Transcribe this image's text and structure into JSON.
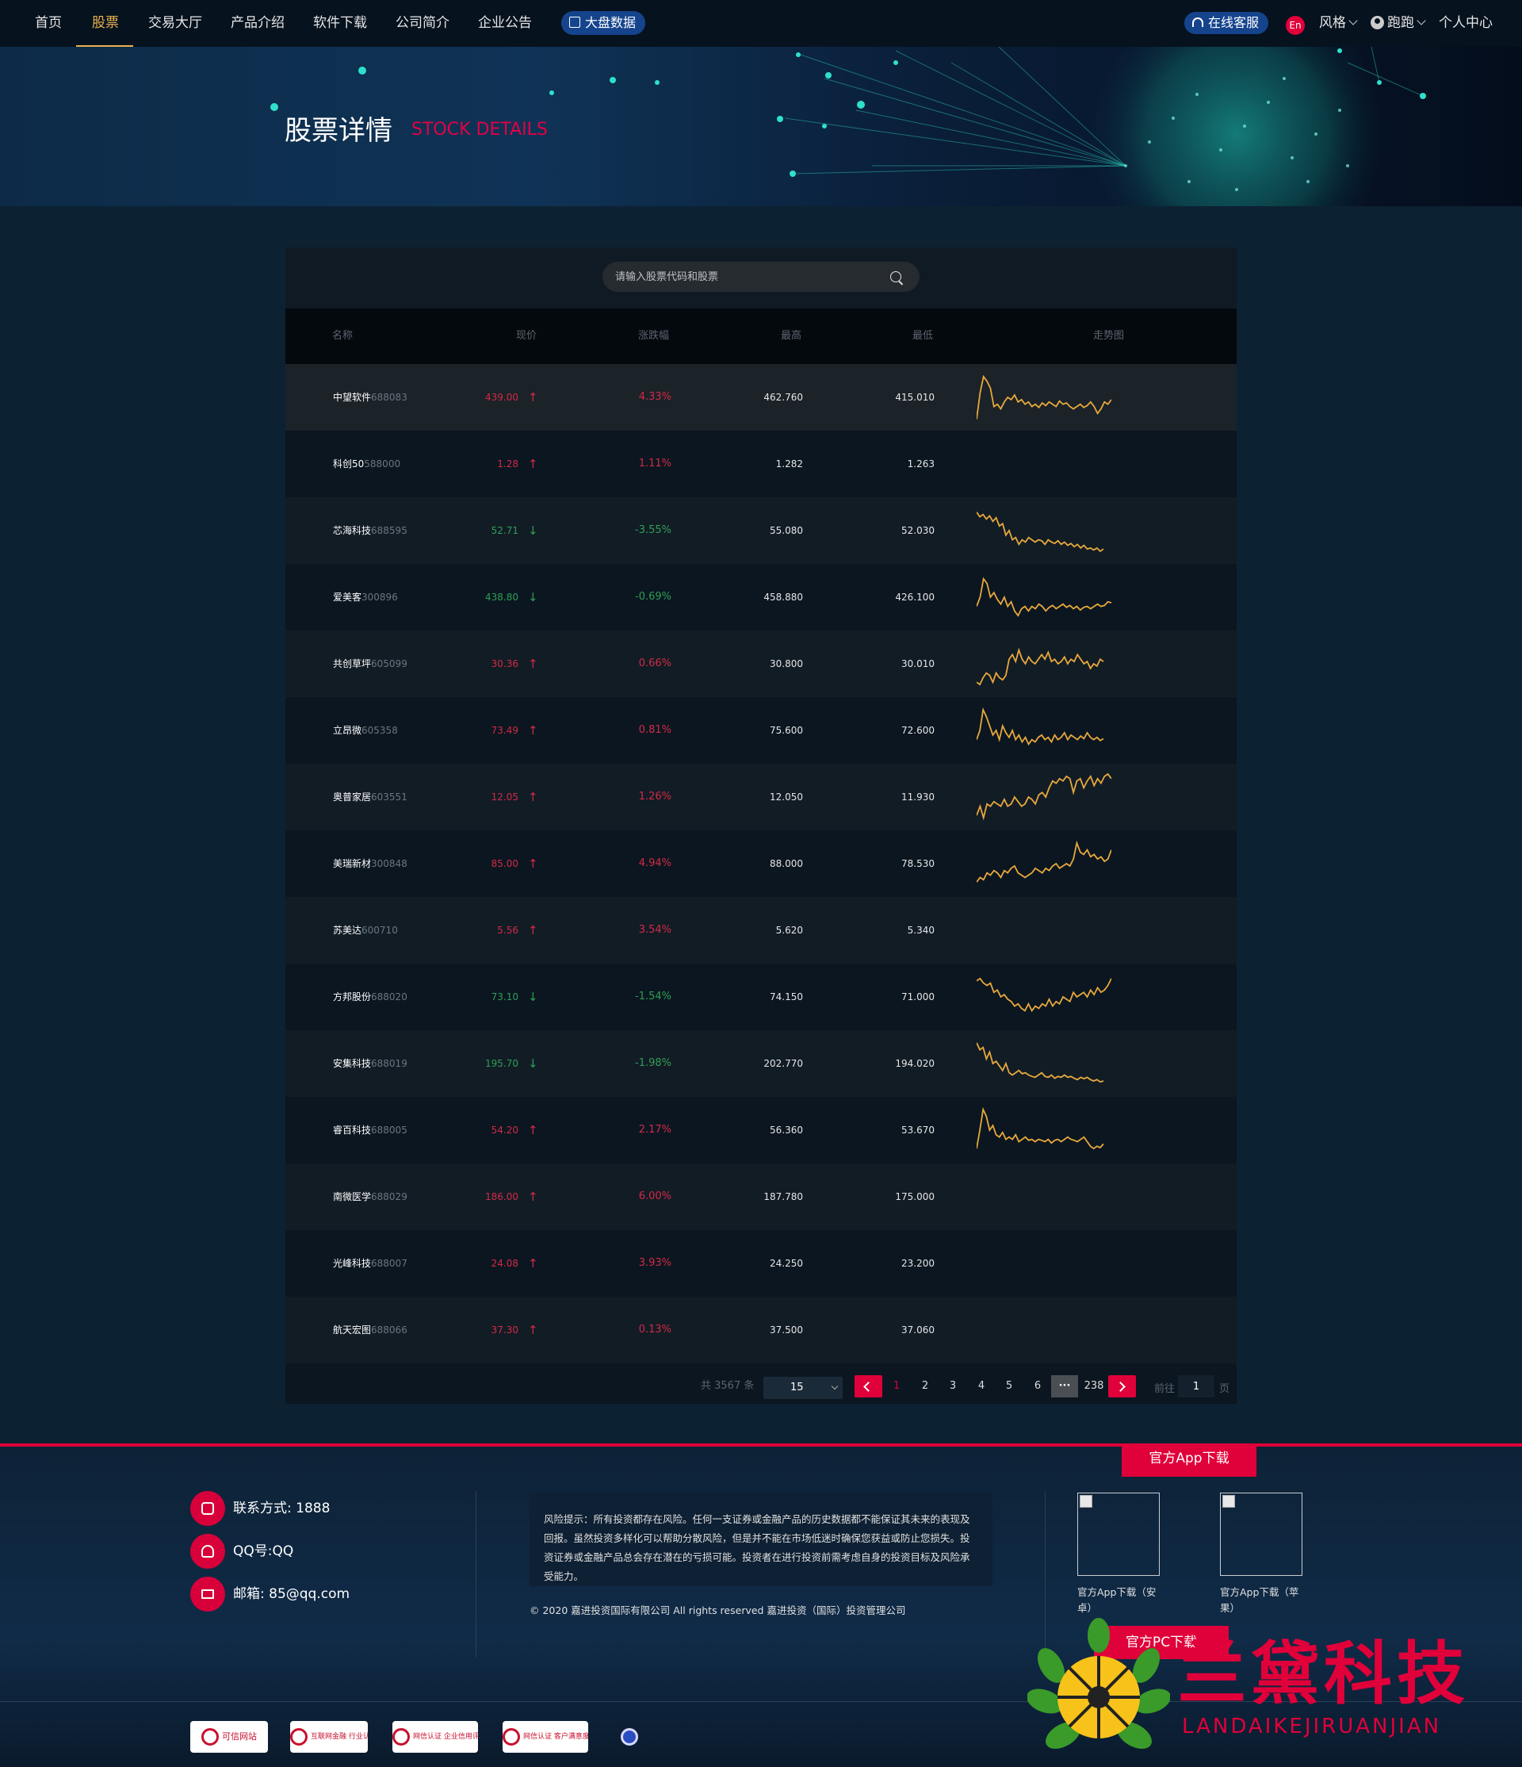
{
  "nav": {
    "items": [
      {
        "label": "首页"
      },
      {
        "label": "股票"
      },
      {
        "label": "交易大厅"
      },
      {
        "label": "产品介绍"
      },
      {
        "label": "软件下载"
      },
      {
        "label": "公司简介"
      },
      {
        "label": "企业公告"
      }
    ],
    "active_index": 1,
    "big_data_label": "大盘数据",
    "service_label": "在线客服",
    "lang_label": "En",
    "style_label": "风格",
    "user_label": "跑跑",
    "personal_center_label": "个人中心"
  },
  "banner": {
    "title": "股票详情",
    "subtitle": "STOCK DETAILS"
  },
  "search": {
    "placeholder": "请输入股票代码和股票"
  },
  "table": {
    "headers": {
      "name": "名称",
      "price": "现价",
      "change": "涨跌幅",
      "high": "最高",
      "low": "最低",
      "trend": "走势图"
    },
    "rows": [
      {
        "name": "中望软件",
        "code": "688083",
        "price": "439.00",
        "direction": "up",
        "change": "4.33%",
        "high": "462.760",
        "low": "415.010",
        "trend": [
          0.02,
          0.6,
          0.95,
          0.85,
          0.7,
          0.3,
          0.35,
          0.25,
          0.4,
          0.5,
          0.45,
          0.55,
          0.4,
          0.45,
          0.35,
          0.4,
          0.3,
          0.35,
          0.28,
          0.38,
          0.32,
          0.4,
          0.35,
          0.3,
          0.42,
          0.35,
          0.38,
          0.3,
          0.25,
          0.3,
          0.35,
          0.28,
          0.32,
          0.4,
          0.3,
          0.15,
          0.25,
          0.4,
          0.35,
          0.45
        ]
      },
      {
        "name": "科创50",
        "code": "588000",
        "price": "1.28",
        "direction": "up",
        "change": "1.11%",
        "high": "1.282",
        "low": "1.263",
        "trend": []
      },
      {
        "name": "芯海科技",
        "code": "688595",
        "price": "52.71",
        "direction": "down",
        "change": "-3.55%",
        "high": "55.080",
        "low": "52.030",
        "trend": [
          0.9,
          0.8,
          0.85,
          0.75,
          0.82,
          0.7,
          0.78,
          0.6,
          0.65,
          0.4,
          0.5,
          0.3,
          0.35,
          0.2,
          0.3,
          0.25,
          0.35,
          0.3,
          0.25,
          0.3,
          0.28,
          0.2,
          0.3,
          0.25,
          0.22,
          0.28,
          0.2,
          0.25,
          0.18,
          0.22,
          0.15,
          0.2,
          0.12,
          0.18,
          0.1,
          0.12,
          0.08,
          0.12,
          0.05,
          0.1
        ]
      },
      {
        "name": "爱美客",
        "code": "300896",
        "price": "438.80",
        "direction": "down",
        "change": "-0.69%",
        "high": "458.880",
        "low": "426.100",
        "trend": [
          0.3,
          0.5,
          0.9,
          0.8,
          0.5,
          0.6,
          0.45,
          0.35,
          0.5,
          0.3,
          0.4,
          0.2,
          0.1,
          0.25,
          0.3,
          0.2,
          0.3,
          0.25,
          0.35,
          0.3,
          0.2,
          0.28,
          0.32,
          0.25,
          0.3,
          0.35,
          0.28,
          0.32,
          0.25,
          0.3,
          0.22,
          0.28,
          0.3,
          0.25,
          0.3,
          0.35,
          0.3,
          0.32,
          0.4,
          0.38
        ]
      },
      {
        "name": "共创草坪",
        "code": "605099",
        "price": "30.36",
        "direction": "up",
        "change": "0.66%",
        "high": "30.800",
        "low": "30.010",
        "trend": [
          0.1,
          0.05,
          0.2,
          0.3,
          0.25,
          0.1,
          0.3,
          0.2,
          0.15,
          0.25,
          0.6,
          0.7,
          0.55,
          0.8,
          0.6,
          0.5,
          0.65,
          0.55,
          0.5,
          0.6,
          0.7,
          0.6,
          0.75,
          0.55,
          0.6,
          0.5,
          0.55,
          0.65,
          0.5,
          0.6,
          0.55,
          0.7,
          0.6,
          0.5,
          0.55,
          0.4,
          0.5,
          0.45,
          0.6,
          0.55
        ]
      },
      {
        "name": "立昂微",
        "code": "605358",
        "price": "73.49",
        "direction": "up",
        "change": "0.81%",
        "high": "75.600",
        "low": "72.600",
        "trend": [
          0.3,
          0.5,
          0.95,
          0.8,
          0.6,
          0.4,
          0.5,
          0.3,
          0.6,
          0.45,
          0.35,
          0.5,
          0.3,
          0.4,
          0.25,
          0.35,
          0.2,
          0.3,
          0.25,
          0.35,
          0.4,
          0.3,
          0.35,
          0.25,
          0.4,
          0.3,
          0.35,
          0.45,
          0.3,
          0.4,
          0.35,
          0.3,
          0.38,
          0.32,
          0.45,
          0.35,
          0.3,
          0.35,
          0.28,
          0.32
        ]
      },
      {
        "name": "奥普家居",
        "code": "603551",
        "price": "12.05",
        "direction": "up",
        "change": "1.26%",
        "high": "12.050",
        "low": "11.930",
        "trend": [
          0.1,
          0.3,
          0.05,
          0.35,
          0.3,
          0.4,
          0.35,
          0.3,
          0.45,
          0.3,
          0.35,
          0.5,
          0.4,
          0.3,
          0.35,
          0.5,
          0.45,
          0.35,
          0.55,
          0.6,
          0.5,
          0.7,
          0.85,
          0.8,
          0.9,
          0.85,
          0.95,
          0.9,
          0.6,
          0.85,
          0.9,
          0.7,
          0.85,
          0.95,
          0.75,
          0.9,
          0.8,
          0.95,
          1.0,
          0.9
        ]
      },
      {
        "name": "美瑞新材",
        "code": "300848",
        "price": "85.00",
        "direction": "up",
        "change": "4.94%",
        "high": "88.000",
        "low": "78.530",
        "trend": [
          0.1,
          0.2,
          0.15,
          0.3,
          0.25,
          0.35,
          0.3,
          0.2,
          0.35,
          0.3,
          0.4,
          0.45,
          0.3,
          0.25,
          0.2,
          0.25,
          0.3,
          0.4,
          0.35,
          0.3,
          0.4,
          0.35,
          0.45,
          0.5,
          0.4,
          0.45,
          0.5,
          0.45,
          0.6,
          0.95,
          0.75,
          0.7,
          0.8,
          0.65,
          0.7,
          0.6,
          0.65,
          0.55,
          0.6,
          0.8
        ]
      },
      {
        "name": "苏美达",
        "code": "600710",
        "price": "5.56",
        "direction": "up",
        "change": "3.54%",
        "high": "5.620",
        "low": "5.340",
        "trend": []
      },
      {
        "name": "方邦股份",
        "code": "688020",
        "price": "73.10",
        "direction": "down",
        "change": "-1.54%",
        "high": "74.150",
        "low": "71.000",
        "trend": [
          0.85,
          0.9,
          0.8,
          0.75,
          0.8,
          0.6,
          0.65,
          0.5,
          0.55,
          0.45,
          0.4,
          0.3,
          0.35,
          0.25,
          0.2,
          0.35,
          0.2,
          0.3,
          0.25,
          0.35,
          0.3,
          0.45,
          0.3,
          0.4,
          0.35,
          0.5,
          0.45,
          0.4,
          0.6,
          0.5,
          0.55,
          0.6,
          0.5,
          0.65,
          0.55,
          0.7,
          0.6,
          0.65,
          0.75,
          0.9
        ]
      },
      {
        "name": "安集科技",
        "code": "688019",
        "price": "195.70",
        "direction": "down",
        "change": "-1.98%",
        "high": "202.770",
        "low": "194.020",
        "trend": [
          0.95,
          0.8,
          0.85,
          0.6,
          0.75,
          0.5,
          0.55,
          0.45,
          0.35,
          0.5,
          0.3,
          0.25,
          0.3,
          0.35,
          0.28,
          0.3,
          0.25,
          0.22,
          0.2,
          0.25,
          0.3,
          0.22,
          0.2,
          0.25,
          0.18,
          0.22,
          0.2,
          0.25,
          0.2,
          0.22,
          0.18,
          0.15,
          0.2,
          0.17,
          0.2,
          0.15,
          0.12,
          0.15,
          0.1,
          0.12
        ]
      },
      {
        "name": "睿百科技",
        "code": "688005",
        "price": "54.20",
        "direction": "up",
        "change": "2.17%",
        "high": "56.360",
        "low": "53.670",
        "trend": [
          0.1,
          0.5,
          0.95,
          0.8,
          0.5,
          0.6,
          0.4,
          0.35,
          0.45,
          0.3,
          0.35,
          0.3,
          0.4,
          0.25,
          0.3,
          0.35,
          0.28,
          0.3,
          0.25,
          0.3,
          0.28,
          0.25,
          0.3,
          0.22,
          0.28,
          0.3,
          0.25,
          0.3,
          0.35,
          0.3,
          0.28,
          0.25,
          0.3,
          0.35,
          0.25,
          0.15,
          0.1,
          0.15,
          0.12,
          0.2
        ]
      },
      {
        "name": "南微医学",
        "code": "688029",
        "price": "186.00",
        "direction": "up",
        "change": "6.00%",
        "high": "187.780",
        "low": "175.000",
        "trend": []
      },
      {
        "name": "光峰科技",
        "code": "688007",
        "price": "24.08",
        "direction": "up",
        "change": "3.93%",
        "high": "24.250",
        "low": "23.200",
        "trend": []
      },
      {
        "name": "航天宏图",
        "code": "688066",
        "price": "37.30",
        "direction": "up",
        "change": "0.13%",
        "high": "37.500",
        "low": "37.060",
        "trend": []
      }
    ]
  },
  "pagination": {
    "total_label": "共 3567 条",
    "page_size": "15",
    "pages": [
      "1",
      "2",
      "3",
      "4",
      "5",
      "6"
    ],
    "ellipsis": "···",
    "last_page": "238",
    "current_page": "1",
    "goto_prefix": "前往",
    "goto_value": "1",
    "goto_suffix": "页"
  },
  "footer": {
    "app_download_tab": "官方App下载",
    "contacts": [
      {
        "icon": "phone-icon",
        "label": "联系方式: 1888"
      },
      {
        "icon": "qq-icon",
        "label": "QQ号:QQ"
      },
      {
        "icon": "mail-icon",
        "label": "邮箱: 85@qq.com"
      }
    ],
    "risk_text": "风险提示：所有投资都存在风险。任何一支证券或金融产品的历史数据都不能保证其未来的表现及回报。虽然投资多样化可以帮助分散风险，但是并不能在市场低迷时确保您获益或防止您损失。投资证券或金融产品总会存在潜在的亏损可能。投资者在进行投资前需考虑自身的投资目标及风险承受能力。",
    "copyright": "© 2020 嘉进投资国际有限公司 All rights reserved 嘉进投资（国际）投资管理公司",
    "qr_android_label": "官方App下载（安卓）",
    "qr_ios_label": "官方App下载（苹果）",
    "pc_download_label": "官方PC下载",
    "badges": [
      "可信网站",
      "互联网金融 行业认证",
      "网信认证 企业信用评级",
      "网信认证 客户满意度测评",
      ""
    ]
  },
  "watermark": {
    "text": "兰黛科技",
    "sub": "LANDAIKEJIRUANJIAN"
  },
  "colors": {
    "accent_red": "#e0003a",
    "active_gold": "#e8b14f",
    "up_red": "#d22a46",
    "down_green": "#2f9e55",
    "spark_line": "#e8a93c",
    "service_blue": "#15448d"
  }
}
